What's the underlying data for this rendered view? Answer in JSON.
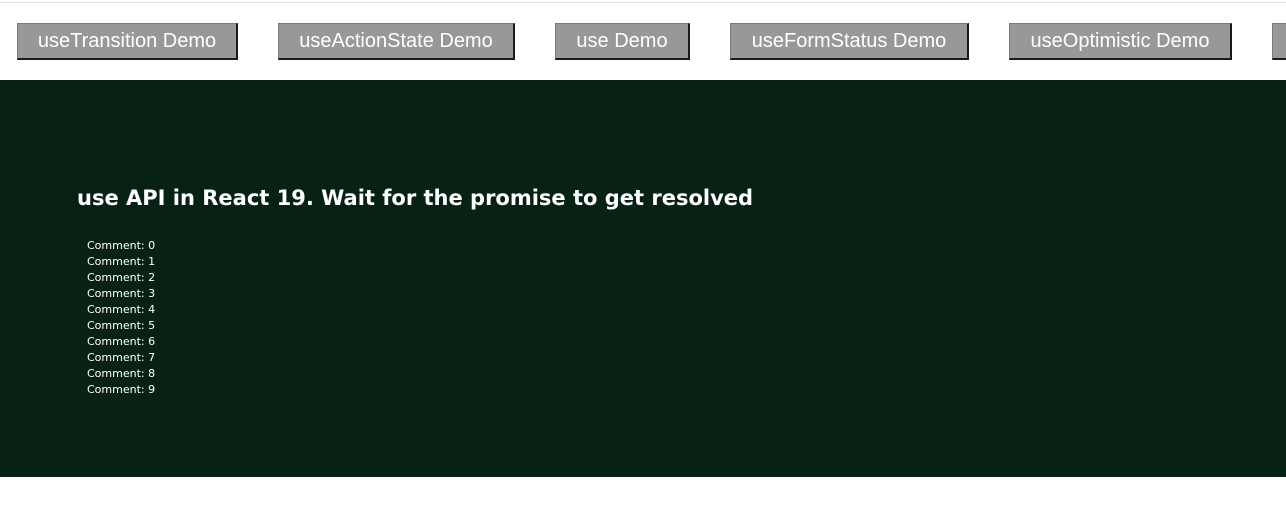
{
  "nav": {
    "buttons": [
      {
        "label": "useTransition Demo"
      },
      {
        "label": "useActionState Demo"
      },
      {
        "label": "use Demo"
      },
      {
        "label": "useFormStatus Demo"
      },
      {
        "label": "useOptimistic Demo"
      },
      {
        "label": ""
      }
    ]
  },
  "main": {
    "heading": "use API in React 19. Wait for the promise to get resolved",
    "comments": [
      "Comment: 0",
      "Comment: 1",
      "Comment: 2",
      "Comment: 3",
      "Comment: 4",
      "Comment: 5",
      "Comment: 6",
      "Comment: 7",
      "Comment: 8",
      "Comment: 9"
    ]
  },
  "colors": {
    "panel_background": "#072215",
    "button_background": "#989898",
    "button_text": "#ffffff",
    "text": "#ffffff"
  }
}
